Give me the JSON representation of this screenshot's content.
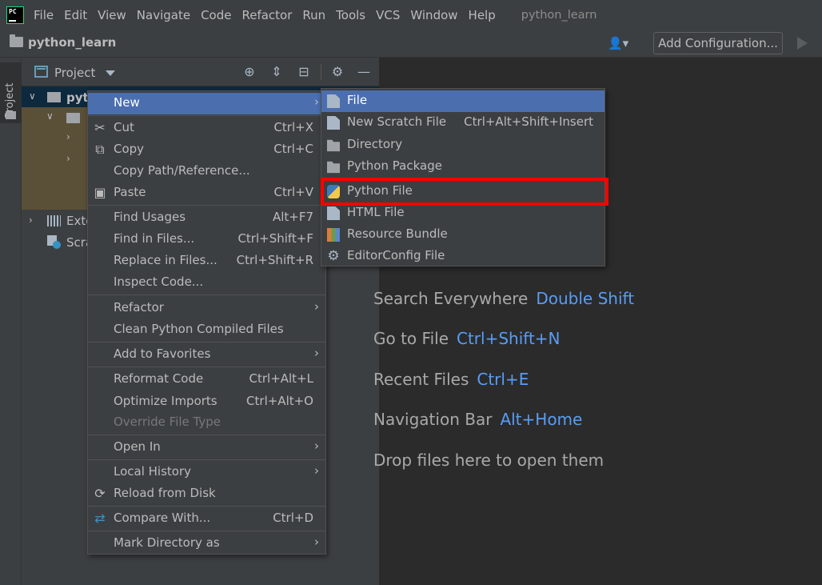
{
  "menubar": {
    "logo_text": "PC",
    "items": [
      "File",
      "Edit",
      "View",
      "Navigate",
      "Code",
      "Refactor",
      "Run",
      "Tools",
      "VCS",
      "Window",
      "Help"
    ],
    "window_title": "python_learn"
  },
  "navbar": {
    "project_name": "python_learn",
    "add_configuration": "Add Configuration..."
  },
  "left_stripe": {
    "project_tab": "Project"
  },
  "project_panel": {
    "title": "Project",
    "tree": {
      "root_label": "pytl",
      "external_label": "Exte",
      "scratches_label": "Scra"
    }
  },
  "context_menu": {
    "items": [
      {
        "label": "New",
        "shortcut": "",
        "submenu": true,
        "highlighted": true,
        "icon": ""
      },
      {
        "label": "Cut",
        "shortcut": "Ctrl+X",
        "icon": "scissors-icon"
      },
      {
        "label": "Copy",
        "shortcut": "Ctrl+C",
        "icon": "copy-icon"
      },
      {
        "label": "Copy Path/Reference...",
        "shortcut": ""
      },
      {
        "label": "Paste",
        "shortcut": "Ctrl+V",
        "icon": "clipboard-icon"
      },
      {
        "label": "Find Usages",
        "shortcut": "Alt+F7"
      },
      {
        "label": "Find in Files...",
        "shortcut": "Ctrl+Shift+F"
      },
      {
        "label": "Replace in Files...",
        "shortcut": "Ctrl+Shift+R"
      },
      {
        "label": "Inspect Code...",
        "shortcut": ""
      },
      {
        "label": "Refactor",
        "submenu": true
      },
      {
        "label": "Clean Python Compiled Files",
        "shortcut": ""
      },
      {
        "label": "Add to Favorites",
        "submenu": true
      },
      {
        "label": "Reformat Code",
        "shortcut": "Ctrl+Alt+L"
      },
      {
        "label": "Optimize Imports",
        "shortcut": "Ctrl+Alt+O"
      },
      {
        "label": "Override File Type",
        "disabled": true
      },
      {
        "label": "Open In",
        "submenu": true
      },
      {
        "label": "Local History",
        "submenu": true
      },
      {
        "label": "Reload from Disk",
        "icon": "reload-icon"
      },
      {
        "label": "Compare With...",
        "shortcut": "Ctrl+D",
        "icon": "compare-icon"
      },
      {
        "label": "Mark Directory as",
        "submenu": true
      }
    ]
  },
  "new_submenu": {
    "items": [
      {
        "label": "File",
        "shortcut": "",
        "icon": "file-icon",
        "highlighted": true
      },
      {
        "label": "New Scratch File",
        "shortcut": "Ctrl+Alt+Shift+Insert",
        "icon": "scratch-file-icon"
      },
      {
        "label": "Directory",
        "shortcut": "",
        "icon": "folder-icon"
      },
      {
        "label": "Python Package",
        "shortcut": "",
        "icon": "python-package-icon"
      },
      {
        "label": "Python File",
        "shortcut": "",
        "icon": "python-file-icon",
        "boxed": true
      },
      {
        "label": "HTML File",
        "shortcut": "",
        "icon": "html-file-icon"
      },
      {
        "label": "Resource Bundle",
        "shortcut": "",
        "icon": "resource-bundle-icon"
      },
      {
        "label": "EditorConfig File",
        "shortcut": "",
        "icon": "gear-icon"
      }
    ]
  },
  "editor_hints": [
    {
      "text": "Search Everywhere",
      "key": "Double Shift"
    },
    {
      "text": "Go to File",
      "key": "Ctrl+Shift+N"
    },
    {
      "text": "Recent Files",
      "key": "Ctrl+E"
    },
    {
      "text": "Navigation Bar",
      "key": "Alt+Home"
    },
    {
      "text": "Drop files here to open them",
      "key": ""
    }
  ],
  "colors": {
    "highlight": "#4b6eaf",
    "link_key": "#589df6",
    "annotation_box": "#ff0000"
  }
}
